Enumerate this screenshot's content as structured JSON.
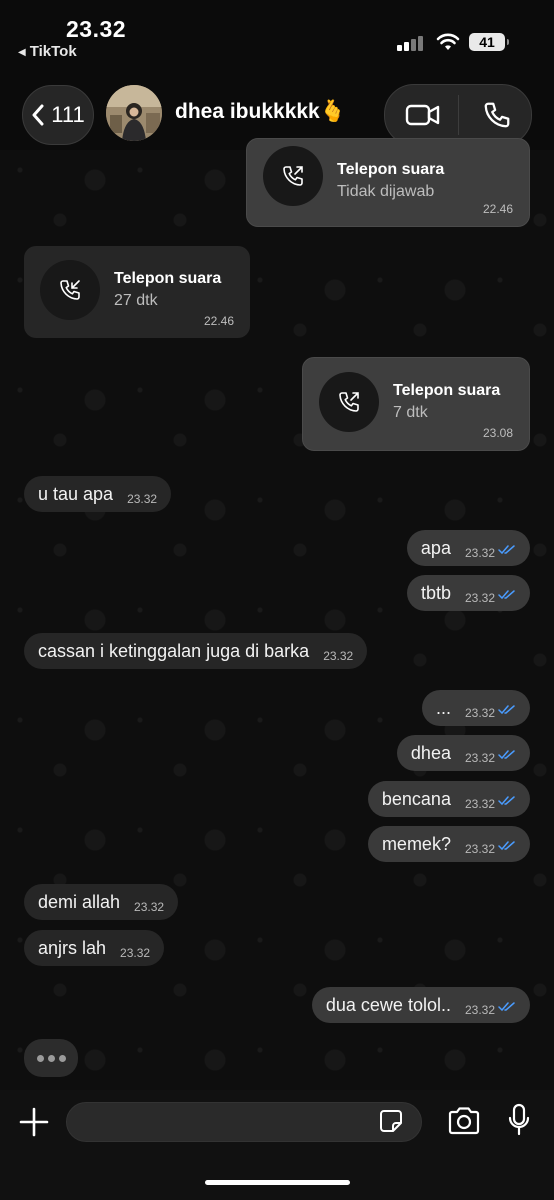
{
  "status_bar": {
    "time": "23.32",
    "back_app": "TikTok",
    "battery": "41"
  },
  "header": {
    "back_count": "111",
    "contact_name": "dhea ibukkkkk🫰"
  },
  "calls": [
    {
      "title": "Telepon suara",
      "subtitle": "Tidak dijawab",
      "time": "22.46",
      "direction": "outgoing"
    },
    {
      "title": "Telepon suara",
      "subtitle": "27 dtk",
      "time": "22.46",
      "direction": "incoming"
    },
    {
      "title": "Telepon suara",
      "subtitle": "7 dtk",
      "time": "23.08",
      "direction": "outgoing"
    }
  ],
  "messages": [
    {
      "text": "u tau apa",
      "time": "23.32",
      "side": "in"
    },
    {
      "text": "apa",
      "time": "23.32",
      "side": "out"
    },
    {
      "text": "tbtb",
      "time": "23.32",
      "side": "out"
    },
    {
      "text": "cassan i ketinggalan juga di barka",
      "time": "23.32",
      "side": "in"
    },
    {
      "text": "...",
      "time": "23.32",
      "side": "out"
    },
    {
      "text": "dhea",
      "time": "23.32",
      "side": "out"
    },
    {
      "text": "bencana",
      "time": "23.32",
      "side": "out"
    },
    {
      "text": "memek?",
      "time": "23.32",
      "side": "out"
    },
    {
      "text": "demi allah",
      "time": "23.32",
      "side": "in"
    },
    {
      "text": "anjrs lah",
      "time": "23.32",
      "side": "in"
    },
    {
      "text": "dua cewe tolol..",
      "time": "23.32",
      "side": "out"
    }
  ],
  "colors": {
    "read_tick": "#4a9cff",
    "outgoing_bubble": "#3a3a3a",
    "incoming_bubble": "#262626"
  },
  "icons": [
    "back-chevron-icon",
    "video-call-icon",
    "phone-icon",
    "outgoing-call-icon",
    "incoming-call-icon",
    "plus-icon",
    "sticker-icon",
    "camera-icon",
    "microphone-icon"
  ]
}
